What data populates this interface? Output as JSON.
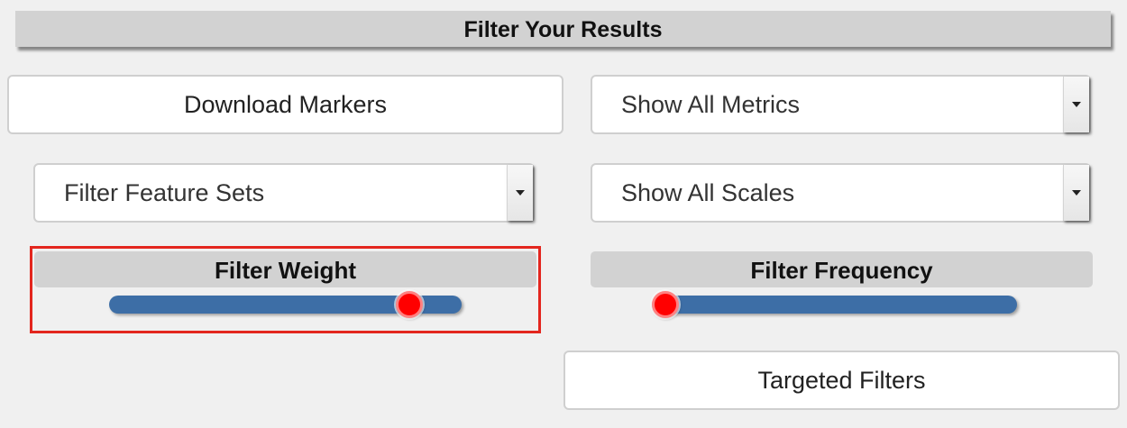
{
  "header": {
    "title": "Filter Your Results"
  },
  "buttons": {
    "download_markers": "Download Markers",
    "targeted_filters": "Targeted Filters"
  },
  "selects": {
    "metrics": "Show All Metrics",
    "feature_sets": "Filter Feature Sets",
    "scales": "Show All Scales"
  },
  "sliders": {
    "weight": {
      "label": "Filter Weight",
      "value_fraction": 0.88
    },
    "frequency": {
      "label": "Filter Frequency",
      "value_fraction": 0.0
    }
  },
  "colors": {
    "track": "#3d6ea6",
    "thumb": "#ff0000",
    "highlight_border": "#e3261e"
  },
  "icons": {
    "dropdown": "chevron-down-icon"
  }
}
